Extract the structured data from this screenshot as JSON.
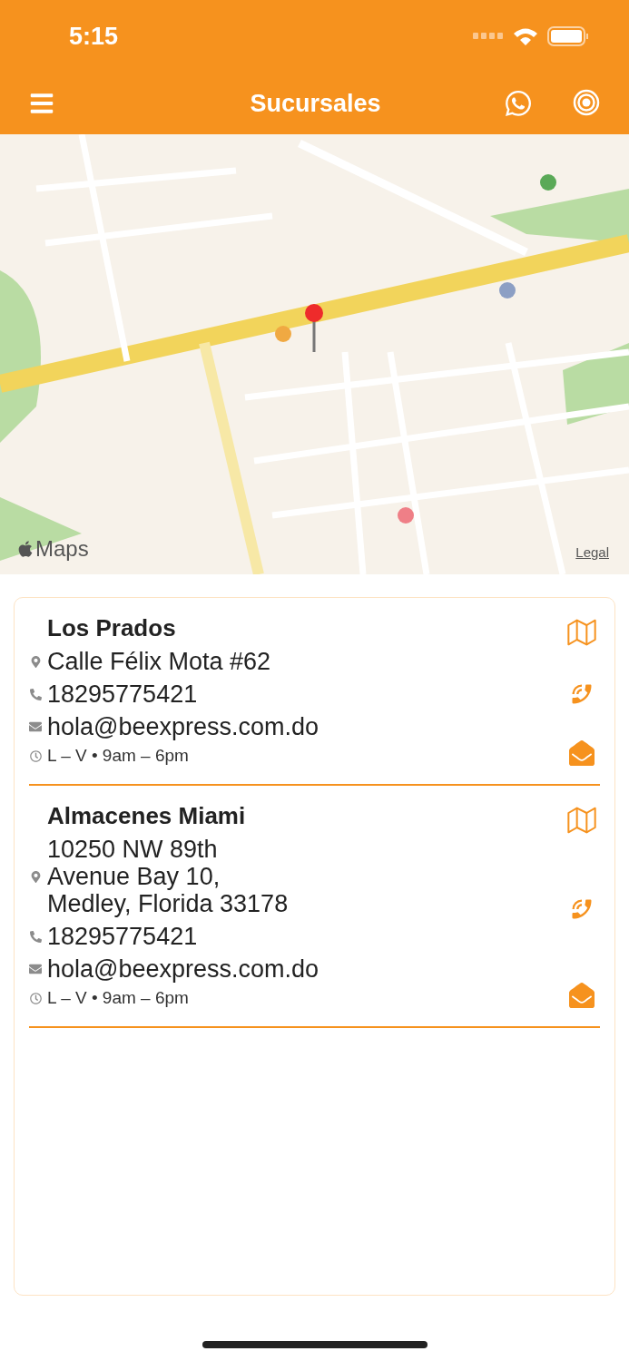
{
  "status_bar": {
    "time": "5:15"
  },
  "nav_bar": {
    "title": "Sucursales"
  },
  "map": {
    "kind": "picture",
    "logo": "Maps",
    "legal": "Legal"
  },
  "branches": [
    {
      "name": "Los Prados",
      "address": "Calle Félix Mota #62",
      "phone": "18295775421",
      "email": "hola@beexpress.com.do",
      "hours": "L – V • 9am – 6pm"
    },
    {
      "name": "Almacenes Miami",
      "address": "10250 NW 89th\nAvenue Bay 10,\nMedley, Florida 33178",
      "phone": "18295775421",
      "email": "hola@beexpress.com.do",
      "hours": "L – V • 9am – 6pm"
    }
  ]
}
